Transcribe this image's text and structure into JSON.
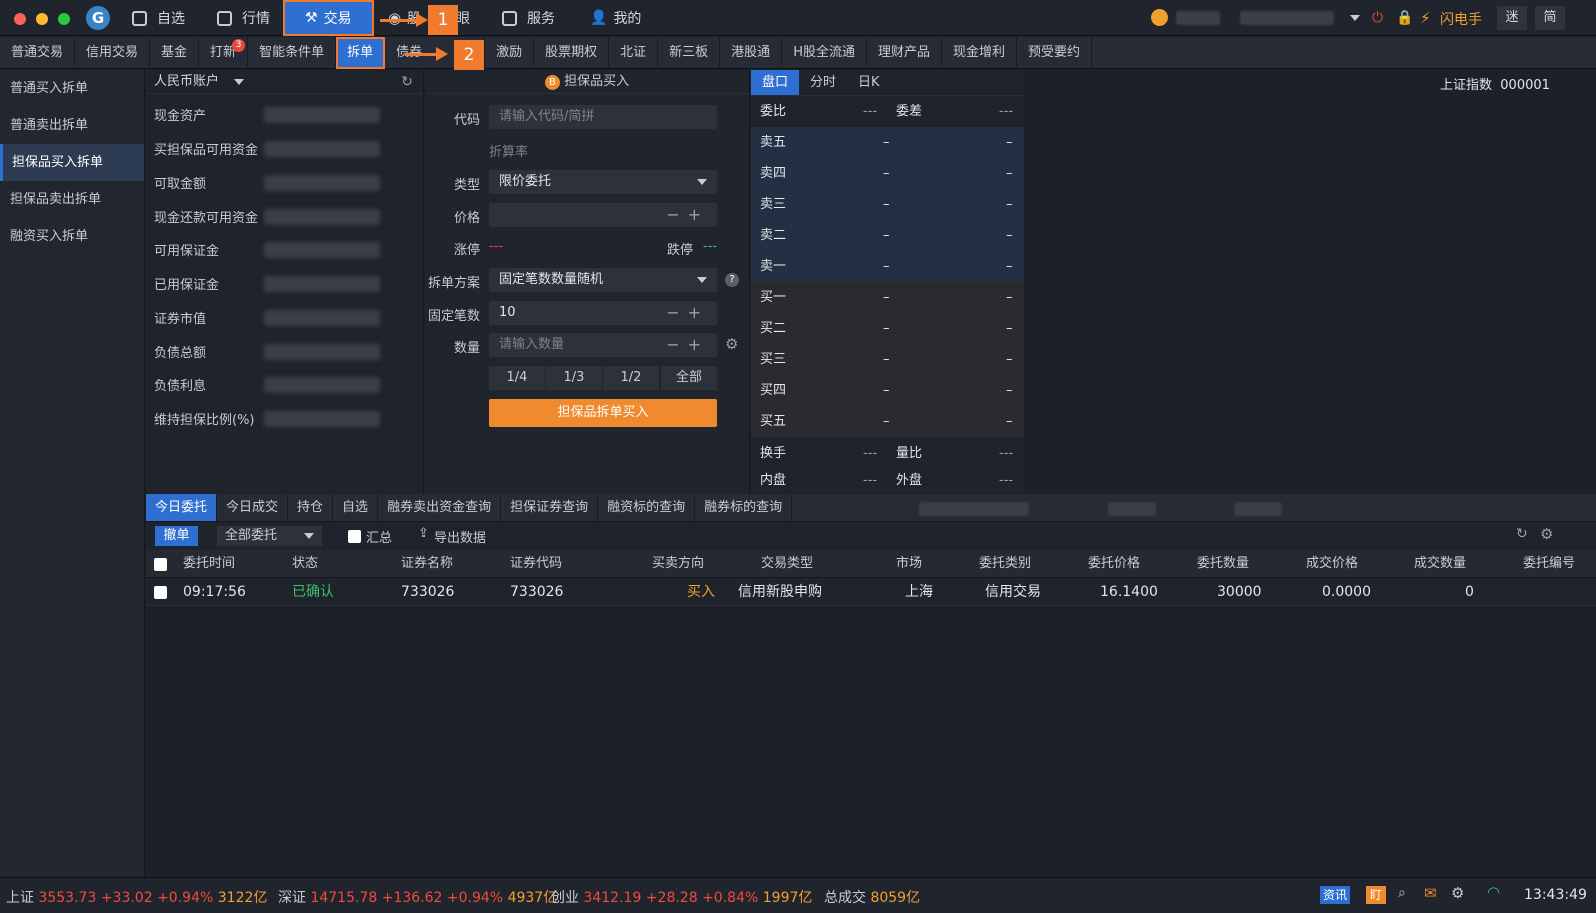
{
  "topbar": {
    "nav": [
      "自选",
      "行情",
      "交易",
      "股",
      "眼",
      "服务",
      "我的"
    ],
    "active_nav": "交易",
    "callout1": "1",
    "callout2": "2",
    "flash_label": "闪电手",
    "btn_mi": "迷",
    "btn_jian": "简"
  },
  "subtabs": [
    {
      "label": "普通交易"
    },
    {
      "label": "信用交易"
    },
    {
      "label": "基金"
    },
    {
      "label": "打新",
      "badge": "3"
    },
    {
      "label": "智能条件单"
    },
    {
      "label": "拆单"
    },
    {
      "label": "债券"
    },
    {
      "label": "激励"
    },
    {
      "label": "股票期权"
    },
    {
      "label": "北证"
    },
    {
      "label": "新三板"
    },
    {
      "label": "港股通"
    },
    {
      "label": "H股全流通"
    },
    {
      "label": "理财产品"
    },
    {
      "label": "现金增利"
    },
    {
      "label": "预受要约"
    }
  ],
  "leftnav": [
    "普通买入拆单",
    "普通卖出拆单",
    "担保品买入拆单",
    "担保品卖出拆单",
    "融资买入拆单"
  ],
  "account": {
    "title": "人民币账户",
    "rows": [
      "现金资产",
      "买担保品可用资金",
      "可取金额",
      "现金还款可用资金",
      "可用保证金",
      "已用保证金",
      "证券市值",
      "负债总额",
      "负债利息",
      "维持担保比例(%)"
    ]
  },
  "form": {
    "title_badge": "B",
    "title": "担保品买入",
    "code_label": "代码",
    "code_placeholder": "请输入代码/简拼",
    "discount_label": "折算率",
    "type_label": "类型",
    "type_value": "限价委托",
    "price_label": "价格",
    "limit_up_label": "涨停",
    "limit_up_value": "---",
    "limit_down_label": "跌停",
    "limit_down_value": "---",
    "plan_label": "拆单方案",
    "plan_value": "固定笔数数量随机",
    "count_label": "固定笔数",
    "count_value": "10",
    "qty_label": "数量",
    "qty_placeholder": "请输入数量",
    "fractions": [
      "1/4",
      "1/3",
      "1/2",
      "全部"
    ],
    "submit": "担保品拆单买入"
  },
  "quote": {
    "tabs": [
      "盘口",
      "分时",
      "日K"
    ],
    "index_label": "上证指数",
    "index_code": "000001",
    "weibi_label": "委比",
    "weibi_value": "---",
    "weicha_label": "委差",
    "weicha_value": "---",
    "sells": [
      "卖五",
      "卖四",
      "卖三",
      "卖二",
      "卖一"
    ],
    "buys": [
      "买一",
      "买二",
      "买三",
      "买四",
      "买五"
    ],
    "dash": "–",
    "turnover_label": "换手",
    "turnover_value": "---",
    "volratio_label": "量比",
    "volratio_value": "---",
    "inner_label": "内盘",
    "inner_value": "---",
    "outer_label": "外盘",
    "outer_value": "---"
  },
  "bottom": {
    "tabs": [
      "今日委托",
      "今日成交",
      "持仓",
      "自选",
      "融券卖出资金查询",
      "担保证券查询",
      "融资标的查询",
      "融券标的查询"
    ],
    "cancel_btn": "撤单",
    "filter": "全部委托",
    "summary": "汇总",
    "export": "导出数据",
    "columns": [
      "委托时间",
      "状态",
      "证券名称",
      "证券代码",
      "买卖方向",
      "交易类型",
      "市场",
      "委托类别",
      "委托价格",
      "委托数量",
      "成交价格",
      "成交数量",
      "委托编号"
    ],
    "rows": [
      {
        "time": "09:17:56",
        "status": "已确认",
        "name": "733026",
        "code": "733026",
        "side": "买入",
        "trade_type": "信用新股申购",
        "market": "上海",
        "category": "信用交易",
        "price": "16.1400",
        "qty": "30000",
        "deal_price": "0.0000",
        "deal_qty": "0"
      }
    ]
  },
  "ticker": {
    "sh_label": "上证",
    "sh_val": "3553.73",
    "sh_chg": "+33.02",
    "sh_pct": "+0.94%",
    "sh_amt": "3122亿",
    "sz_label": "深证",
    "sz_val": "14715.78",
    "sz_chg": "+136.62",
    "sz_pct": "+0.94%",
    "sz_amt": "4937亿",
    "cy_label": "创业",
    "cy_val": "3412.19",
    "cy_chg": "+28.28",
    "cy_pct": "+0.84%",
    "cy_amt": "1997亿",
    "total_label": "总成交",
    "total_amt": "8059亿",
    "news_btn": "资讯",
    "ding_btn": "盯",
    "time": "13:43:49"
  }
}
